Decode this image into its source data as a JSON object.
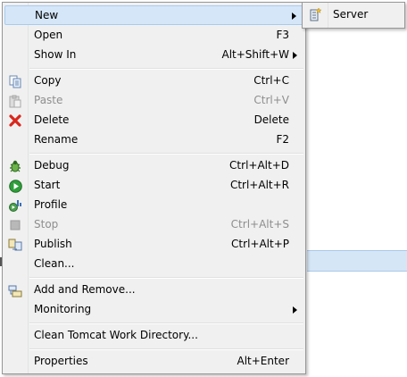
{
  "menu": {
    "items": [
      {
        "label": "New",
        "accel": "",
        "submenu": true,
        "icon": null,
        "disabled": false,
        "hover": true
      },
      {
        "label": "Open",
        "accel": "F3",
        "submenu": false,
        "icon": null,
        "disabled": false
      },
      {
        "label": "Show In",
        "accel": "Alt+Shift+W",
        "submenu": true,
        "icon": null,
        "disabled": false
      },
      {
        "label": "Copy",
        "accel": "Ctrl+C",
        "submenu": false,
        "icon": "copy-icon",
        "disabled": false
      },
      {
        "label": "Paste",
        "accel": "Ctrl+V",
        "submenu": false,
        "icon": "paste-icon",
        "disabled": true
      },
      {
        "label": "Delete",
        "accel": "Delete",
        "submenu": false,
        "icon": "delete-icon",
        "disabled": false
      },
      {
        "label": "Rename",
        "accel": "F2",
        "submenu": false,
        "icon": null,
        "disabled": false
      },
      {
        "label": "Debug",
        "accel": "Ctrl+Alt+D",
        "submenu": false,
        "icon": "debug-icon",
        "disabled": false
      },
      {
        "label": "Start",
        "accel": "Ctrl+Alt+R",
        "submenu": false,
        "icon": "start-icon",
        "disabled": false
      },
      {
        "label": "Profile",
        "accel": "",
        "submenu": false,
        "icon": "profile-icon",
        "disabled": false
      },
      {
        "label": "Stop",
        "accel": "Ctrl+Alt+S",
        "submenu": false,
        "icon": "stop-icon",
        "disabled": true
      },
      {
        "label": "Publish",
        "accel": "Ctrl+Alt+P",
        "submenu": false,
        "icon": "publish-icon",
        "disabled": false
      },
      {
        "label": "Clean...",
        "accel": "",
        "submenu": false,
        "icon": null,
        "disabled": false
      },
      {
        "label": "Add and Remove...",
        "accel": "",
        "submenu": false,
        "icon": "add-remove-icon",
        "disabled": false
      },
      {
        "label": "Monitoring",
        "accel": "",
        "submenu": true,
        "icon": null,
        "disabled": false
      },
      {
        "label": "Clean Tomcat Work Directory...",
        "accel": "",
        "submenu": false,
        "icon": null,
        "disabled": false
      },
      {
        "label": "Properties",
        "accel": "Alt+Enter",
        "submenu": false,
        "icon": null,
        "disabled": false
      }
    ]
  },
  "submenu": {
    "items": [
      {
        "label": "Server",
        "icon": "new-server-icon"
      }
    ]
  },
  "colors": {
    "menu_bg": "#f0f0f0",
    "hover_bg": "#d5e6f8",
    "disabled_text": "#8e8e8e",
    "delete_red": "#d9261c",
    "start_green": "#2f9e3a"
  }
}
